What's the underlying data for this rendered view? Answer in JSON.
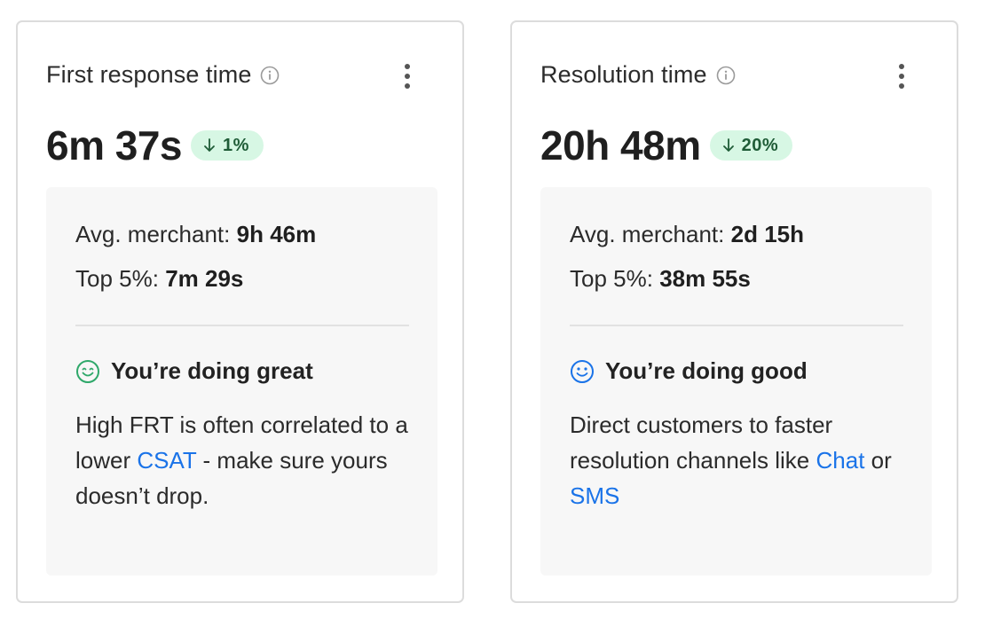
{
  "cards": [
    {
      "title": "First response time",
      "value": "6m 37s",
      "delta": "1%",
      "avg_merchant_label": "Avg. merchant:",
      "avg_merchant_value": "9h 46m",
      "top5_label": "Top 5%:",
      "top5_value": "7m 29s",
      "status": "You’re doing great",
      "status_icon": "happy-face-icon",
      "status_color": "#2fa86a",
      "advice_part1": "High FRT is often correlated to a lower ",
      "advice_link1": "CSAT",
      "advice_part2": " - make sure yours doesn’t drop."
    },
    {
      "title": "Resolution time",
      "value": "20h 48m",
      "delta": "20%",
      "avg_merchant_label": "Avg. merchant:",
      "avg_merchant_value": "2d 15h",
      "top5_label": "Top 5%:",
      "top5_value": "38m 55s",
      "status": "You’re doing good",
      "status_icon": "smiley-face-icon",
      "status_color": "#1a73e8",
      "advice_part1": "Direct customers to faster resolution channels like ",
      "advice_link1": "Chat",
      "advice_part2": " or ",
      "advice_link2": "SMS"
    }
  ],
  "colors": {
    "badge_bg": "#d7f7e4",
    "badge_text": "#1f5c37",
    "link": "#1a73e8",
    "panel_bg": "#f7f7f7",
    "border": "#dcdcdc"
  }
}
